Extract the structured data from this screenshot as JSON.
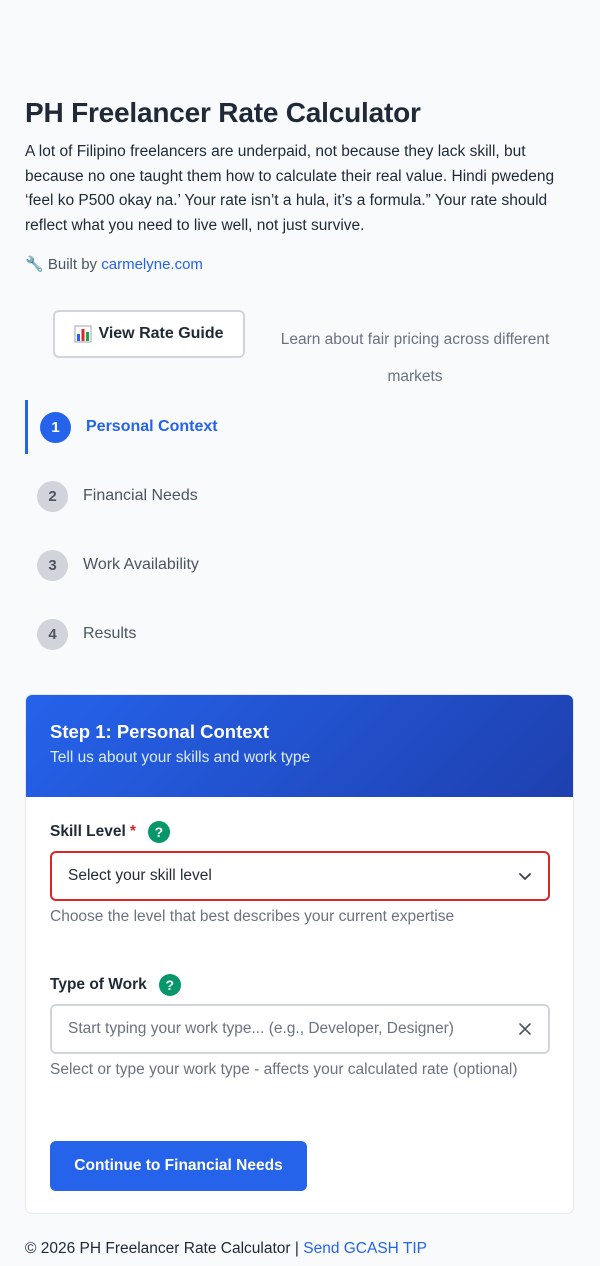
{
  "header": {
    "title": "PH Freelancer Rate Calculator",
    "intro": "A lot of Filipino freelancers are underpaid, not because they lack skill, but because no one taught them how to calculate their real value. Hindi pwedeng ‘feel ko P500 okay na.’ Your rate isn’t a hula, it’s a formula.” Your rate should reflect what you need to live well, not just survive.",
    "built_prefix": "Built by",
    "built_link": "carmelyne.com",
    "built_icon": "wrench-icon"
  },
  "guide": {
    "button_label": "View Rate Guide",
    "button_icon": "bar-chart-icon",
    "note": "Learn about fair pricing across different markets"
  },
  "steps": [
    {
      "num": "1",
      "label": "Personal Context",
      "active": true
    },
    {
      "num": "2",
      "label": "Financial Needs",
      "active": false
    },
    {
      "num": "3",
      "label": "Work Availability",
      "active": false
    },
    {
      "num": "4",
      "label": "Results",
      "active": false
    }
  ],
  "card": {
    "title": "Step 1: Personal Context",
    "subtitle": "Tell us about your skills and work type",
    "skill": {
      "label": "Skill Level",
      "required_mark": "*",
      "help": "?",
      "selected": "Select your skill level",
      "hint": "Choose the level that best describes your current expertise"
    },
    "work": {
      "label": "Type of Work",
      "help": "?",
      "placeholder": "Start typing your work type... (e.g., Developer, Designer)",
      "hint": "Select or type your work type - affects your calculated rate (optional)"
    },
    "continue_label": "Continue to Financial Needs"
  },
  "footer": {
    "text": "© 2026 PH Freelancer Rate Calculator |",
    "link": "Send GCASH TIP"
  },
  "colors": {
    "accent": "#2563eb",
    "error": "#dc2626",
    "help": "#059669"
  }
}
